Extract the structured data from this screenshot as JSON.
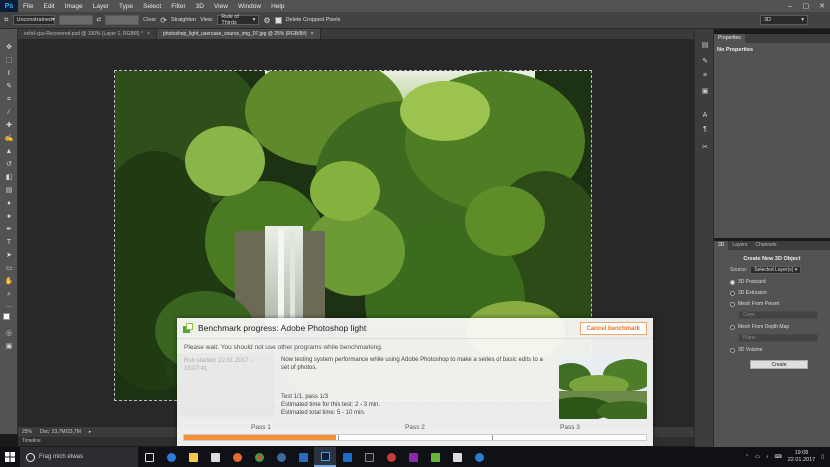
{
  "menubar": {
    "items": [
      "File",
      "Edit",
      "Image",
      "Layer",
      "Type",
      "Select",
      "Filter",
      "3D",
      "View",
      "Window",
      "Help"
    ]
  },
  "optionsbar": {
    "ratio_select": "Unconstrained",
    "straighten_label": "Straighten",
    "view_label": "View:",
    "view_select": "Rule of Thirds",
    "delete_cropped_label": "Delete Cropped Pixels",
    "workspace": "3D"
  },
  "tabs": [
    {
      "label": "echd-cpu-Recovered.psd @ 100% (Layer 1, RGB/8) *"
    },
    {
      "label": "photoshop_light_usercase_source_img_07.jpg @ 25% (RGB/8#)"
    }
  ],
  "statusbar": {
    "zoom": "25%",
    "doc_info": "Doc: 23,7M/23,7M"
  },
  "timeline_label": "Timeline",
  "properties": {
    "tab": "Properties",
    "title": "No Properties"
  },
  "panel3d": {
    "tabs": [
      "3D",
      "Layers",
      "Channels"
    ],
    "title": "Create New 3D Object",
    "source_label": "Source:",
    "source_value": "Selected Layer(s)",
    "options": [
      {
        "label": "3D Postcard",
        "selected": true
      },
      {
        "label": "3D Extrusion",
        "selected": false
      },
      {
        "label": "Mesh From Preset",
        "selected": false
      },
      {
        "label": "Mesh From Depth Map",
        "selected": false
      },
      {
        "label": "3D Volume",
        "selected": false
      }
    ],
    "preset_select": "Cone",
    "depth_select": "Plane",
    "create_button": "Create"
  },
  "benchmark": {
    "title": "Benchmark progress: Adobe Photoshop light",
    "cancel_label": "Cancel benchmark",
    "warning": "Please wait. You should not use other programs while benchmarking.",
    "run_started_line1": "Run started: 22.01.2017 -",
    "run_started_line2": "19:07:41",
    "description": "Now testing system performance while using Adobe Photoshop to make a series of basic edits to a set of photos.",
    "test_line": "Test 1/1, pass 1/3",
    "est_test": "Estimated time for this test: 2 - 3 min.",
    "est_total": "Estimated total time: 5 - 10 min.",
    "passes": [
      "Pass 1",
      "Pass 2",
      "Pass 3"
    ],
    "progress": 0.33,
    "accent_color": "#f39237"
  },
  "taskbar": {
    "search_placeholder": "Frag mich etwas",
    "time": "19:08",
    "date": "22.01.2017"
  }
}
